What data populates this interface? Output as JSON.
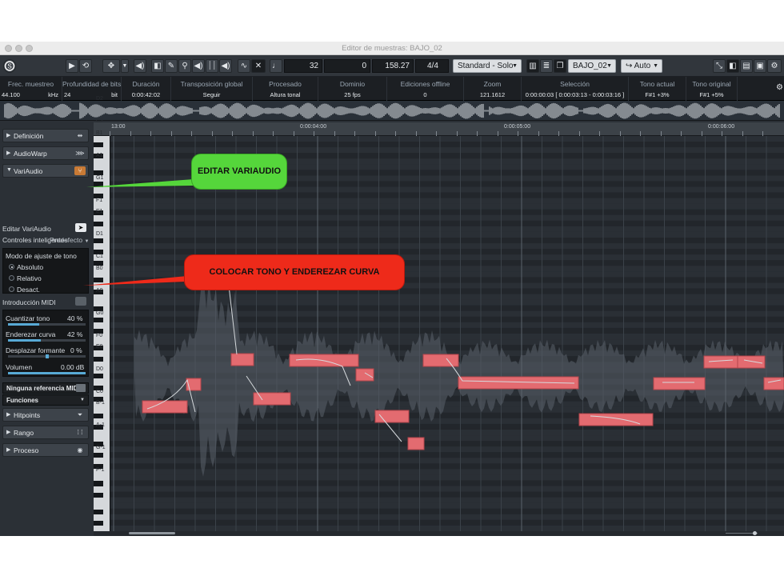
{
  "window": {
    "title": "Editor de muestras: BAJO_02"
  },
  "toolbar": {
    "app_icon": "cubase-logo-icon",
    "field_value_1": "32",
    "field_value_2": "0",
    "tempo": "158.27",
    "time_signature": "4/4",
    "algorithm_select": "Standard - Solo",
    "track_select": "BAJO_02",
    "auto_select": "Auto"
  },
  "info_line": [
    {
      "header": "Frec. muestreo",
      "value": "44.100",
      "unit": "kHz"
    },
    {
      "header": "Profundidad de bits",
      "value": "24",
      "unit": "bit"
    },
    {
      "header": "Duración",
      "value": "0:00:42:02"
    },
    {
      "header": "Transposición global",
      "value": "Seguir"
    },
    {
      "header": "Procesado",
      "value": "Altura tonal"
    },
    {
      "header": "Dominio",
      "value": "25 fps"
    },
    {
      "header": "Ediciones offline",
      "value": "0"
    },
    {
      "header": "Zoom",
      "value": "121.1612"
    },
    {
      "header": "Selección",
      "value": "0:00:00:03 [ 0:00:03:13 - 0:00:03:16 ]"
    },
    {
      "header": "Tono actual",
      "value": "F#1 +3%"
    },
    {
      "header": "Tono original",
      "value": "F#1 +5%"
    }
  ],
  "inspector": {
    "sections": {
      "definicion": "Definición",
      "audiowarp": "AudioWarp",
      "variaudio": "VariAudio",
      "hitpoints": "Hitpoints",
      "rango": "Rango",
      "proceso": "Proceso"
    },
    "editar_variaudio": "Editar VariAudio",
    "controles_inteligentes": "Controles inteligentes",
    "controles_value": "Predefecto",
    "modo_ajuste_label": "Modo de ajuste de tono",
    "modo_options": [
      "Absoluto",
      "Relativo",
      "Desact."
    ],
    "modo_selected": "Absoluto",
    "introduccion_midi": "Introducción MIDI",
    "cuantizar_tono": {
      "label": "Cuantizar tono",
      "value": "40 %",
      "level": 40
    },
    "enderezar_curva": {
      "label": "Enderezar curva",
      "value": "42 %",
      "level": 42
    },
    "desplazar_formante": {
      "label": "Desplazar formante",
      "value": "0 %",
      "level": 50
    },
    "volumen": {
      "label": "Volumen",
      "value": "0.00 dB",
      "level": 100
    },
    "midi_ref": "Ninguna referencia MIDI",
    "funciones": "Funciones"
  },
  "ruler": {
    "labels": [
      "13:00",
      "0:00:04:00",
      "0:00:05:00",
      "0:00:06:00"
    ]
  },
  "piano_keys": [
    "D2",
    "C2",
    "B1",
    "A1",
    "G1",
    "F1",
    "E1",
    "D1",
    "C1",
    "B0",
    "A0",
    "G0",
    "F0",
    "E0",
    "D0",
    "C0",
    "B-1",
    "A-1",
    "G-1",
    "F-1"
  ],
  "callouts": {
    "editar": "EDITAR VARIAUDIO",
    "colocar": "COLOCAR TONO Y ENDEREZAR CURVA"
  },
  "colors": {
    "callout_green": "#55d63b",
    "callout_red": "#ee2a1a",
    "segment_fill": "#e36b70",
    "accent_blue": "#58aad6"
  }
}
